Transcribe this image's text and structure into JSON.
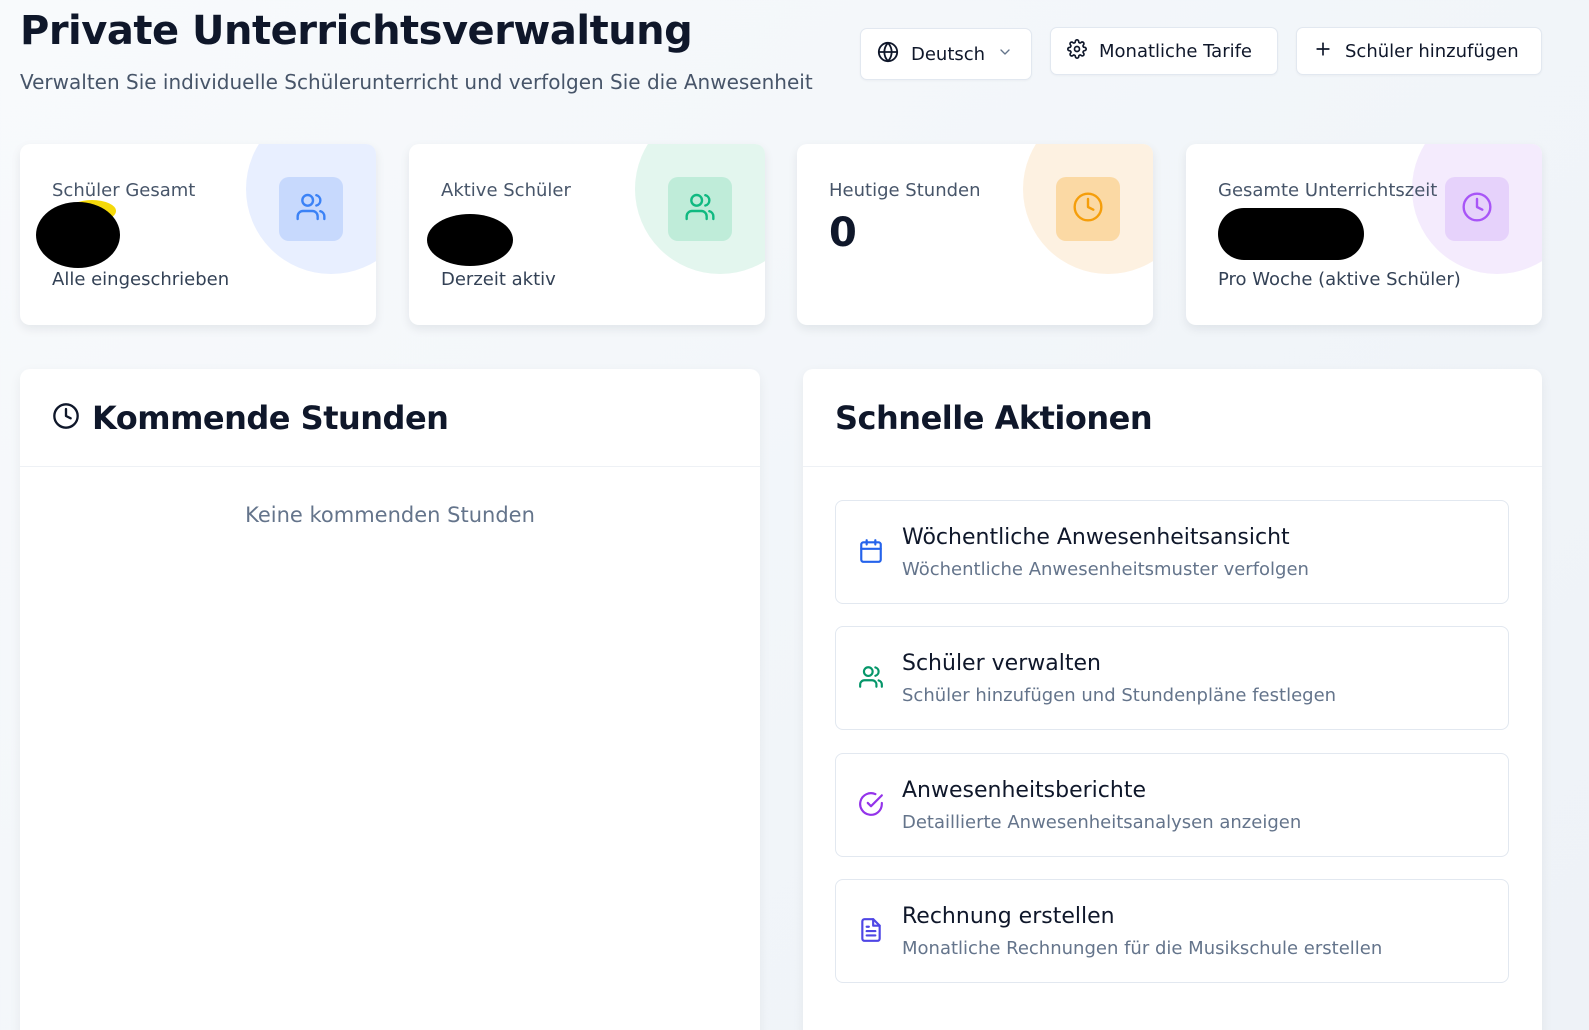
{
  "header": {
    "title": "Private Unterrichtsverwaltung",
    "subtitle": "Verwalten Sie individuelle Schülerunterricht und verfolgen Sie die Anwesenheit",
    "language_label": "Deutsch",
    "tariffs_label": "Monatliche Tarife",
    "add_student_label": "Schüler hinzufügen"
  },
  "stats": [
    {
      "label": "Schüler Gesamt",
      "value": "",
      "note": "Alle eingeschrieben",
      "icon": "users-icon",
      "color": "#3b82f6"
    },
    {
      "label": "Aktive Schüler",
      "value": "",
      "note": "Derzeit aktiv",
      "icon": "users-icon",
      "color": "#10b981"
    },
    {
      "label": "Heutige Stunden",
      "value": "0",
      "note": "",
      "icon": "clock-icon",
      "color": "#f59e0b"
    },
    {
      "label": "Gesamte Unterrichtszeit",
      "value": "",
      "note": "Pro Woche (aktive Schüler)",
      "icon": "clock-icon",
      "color": "#a855f7"
    }
  ],
  "upcoming": {
    "title": "Kommende Stunden",
    "empty_text": "Keine kommenden Stunden"
  },
  "quick_actions": {
    "title": "Schnelle Aktionen",
    "items": [
      {
        "title": "Wöchentliche Anwesenheitsansicht",
        "description": "Wöchentliche Anwesenheitsmuster verfolgen",
        "icon": "calendar-icon",
        "color": "#2563eb"
      },
      {
        "title": "Schüler verwalten",
        "description": "Schüler hinzufügen und Stundenpläne festlegen",
        "icon": "users-icon",
        "color": "#059669"
      },
      {
        "title": "Anwesenheitsberichte",
        "description": "Detaillierte Anwesenheitsanalysen anzeigen",
        "icon": "check-circle-icon",
        "color": "#9333ea"
      },
      {
        "title": "Rechnung erstellen",
        "description": "Monatliche Rechnungen für die Musikschule erstellen",
        "icon": "file-text-icon",
        "color": "#4f46e5"
      }
    ]
  }
}
